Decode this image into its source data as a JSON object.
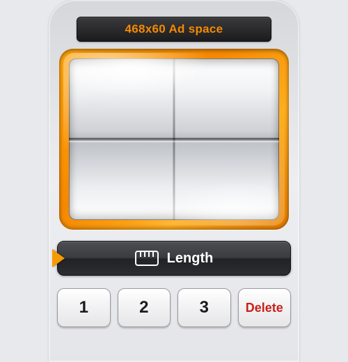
{
  "colors": {
    "accent": "#f58a00",
    "delete": "#c9201a"
  },
  "ad": {
    "label": "468x60 Ad space"
  },
  "mode": {
    "label": "Length",
    "icon": "ruler-icon"
  },
  "keypad": {
    "keys": [
      {
        "label": "1"
      },
      {
        "label": "2"
      },
      {
        "label": "3"
      }
    ],
    "delete_label": "Delete"
  }
}
